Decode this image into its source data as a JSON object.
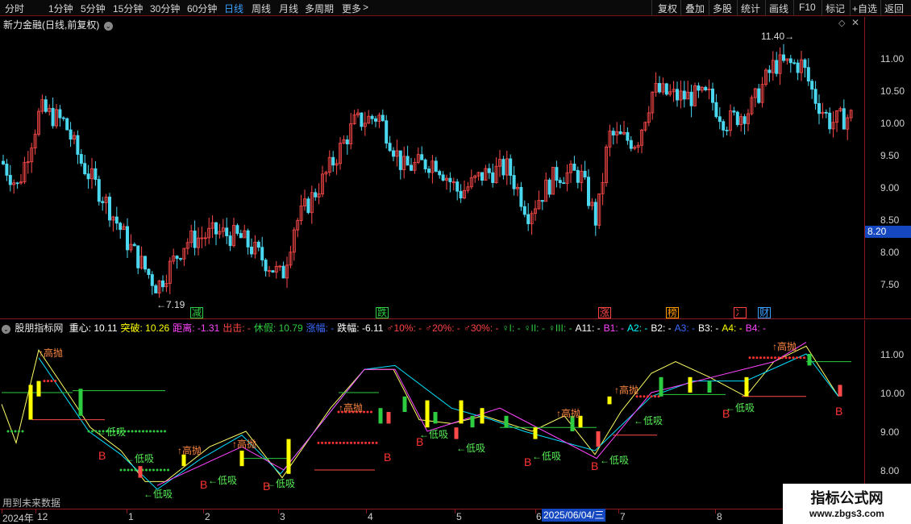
{
  "toolbar": {
    "left_tabs": [
      {
        "label": "分时",
        "selected": false
      },
      {
        "label": "1分钟",
        "selected": false
      },
      {
        "label": "5分钟",
        "selected": false
      },
      {
        "label": "15分钟",
        "selected": false
      },
      {
        "label": "30分钟",
        "selected": false
      },
      {
        "label": "60分钟",
        "selected": false
      },
      {
        "label": "日线",
        "selected": true
      },
      {
        "label": "周线",
        "selected": false
      },
      {
        "label": "月线",
        "selected": false
      },
      {
        "label": "多周期",
        "selected": false
      },
      {
        "label": "更多",
        "selected": false
      }
    ],
    "more_arrow": ">",
    "right_buttons": [
      "复权",
      "叠加",
      "多股",
      "统计",
      "画线",
      "F10",
      "标记",
      "+自选",
      "返回"
    ]
  },
  "main_chart": {
    "title": "新力金融(日线,前复权)",
    "y_ticks": [
      "11.00",
      "10.50",
      "10.00",
      "9.50",
      "9.00",
      "8.50",
      "8.00",
      "7.50"
    ],
    "current_price": "8.20",
    "high_label": "11.40",
    "low_label": "7.19",
    "news_tags": [
      {
        "text": "减",
        "color": "#2ecc40"
      },
      {
        "text": "跌",
        "color": "#2ecc40"
      },
      {
        "text": "涨",
        "color": "#ff4444"
      },
      {
        "text": "榜",
        "color": "#ff9900"
      },
      {
        "text": "冫",
        "color": "#ff4444"
      },
      {
        "text": "财",
        "color": "#3aa0ff"
      }
    ]
  },
  "indicator": {
    "name": "股朋指标网",
    "fields": [
      {
        "text": "重心: 10.11",
        "color": "#ffffff"
      },
      {
        "text": "突破: 10.26",
        "color": "#ffff00"
      },
      {
        "text": "距离: -1.31",
        "color": "#ff44ff"
      },
      {
        "text": "出击: -",
        "color": "#ff4444"
      },
      {
        "text": "休假: 10.79",
        "color": "#2ecc40"
      },
      {
        "text": "涨幅: -",
        "color": "#3a6aff"
      },
      {
        "text": "跌幅: -6.11",
        "color": "#ffffff"
      },
      {
        "text": "♂10%: -",
        "color": "#ff4444"
      },
      {
        "text": "♂20%: -",
        "color": "#ff4444"
      },
      {
        "text": "♂30%: -",
        "color": "#ff4444"
      },
      {
        "text": "♀I: -",
        "color": "#2ecc40"
      },
      {
        "text": "♀II: -",
        "color": "#2ecc40"
      },
      {
        "text": "♀III: -",
        "color": "#2ecc40"
      },
      {
        "text": "A11: -",
        "color": "#ffffff"
      },
      {
        "text": "B1: -",
        "color": "#ff44ff"
      },
      {
        "text": "A2: -",
        "color": "#00ffff"
      },
      {
        "text": "B2: -",
        "color": "#ffffff"
      },
      {
        "text": "A3: -",
        "color": "#3a6aff"
      },
      {
        "text": "B3: -",
        "color": "#ffffff"
      },
      {
        "text": "A4: -",
        "color": "#ffff00"
      },
      {
        "text": "B4: -",
        "color": "#ff44ff"
      }
    ],
    "y_ticks": [
      "11.00",
      "10.00",
      "9.00",
      "8.00"
    ],
    "labels": {
      "high_sell": "高抛",
      "low_buy": "低吸",
      "buy": "B"
    },
    "future_note": "用到未来数据"
  },
  "date_axis": {
    "labels": [
      "2024年",
      "12",
      "1",
      "2",
      "3",
      "4",
      "5",
      "6",
      "7",
      "8"
    ],
    "cursor_date": "2025/06/04/三"
  },
  "watermark": {
    "title": "指标公式网",
    "url": "www.zbgs3.com"
  },
  "colors": {
    "up": "#ff4a4a",
    "down": "#4ad8f0",
    "frame": "#8a1a1a",
    "accent": "#1447c0"
  }
}
